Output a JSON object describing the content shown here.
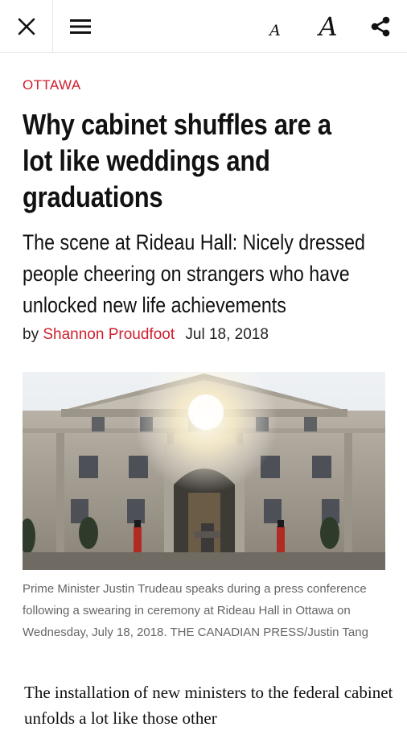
{
  "toolbar": {
    "close_icon": "close-icon",
    "menu_icon": "hamburger-menu-icon",
    "font_small_label": "A",
    "font_large_label": "A",
    "share_icon": "share-icon"
  },
  "article": {
    "section": "OTTAWA",
    "headline": "Why cabinet shuffles are a lot like weddings and graduations",
    "dek": "The scene at Rideau Hall: Nicely dressed people cheering on strangers who have unlocked new life achievements",
    "by_prefix": "by",
    "author": "Shannon Proudfoot",
    "date": "Jul 18, 2018",
    "caption": "Prime Minister Justin Trudeau speaks during a press conference following a swearing in ceremony at Rideau Hall in Ottawa on Wednesday, July 18, 2018. THE CANADIAN PRESS/Justin Tang",
    "body_start": "The installation of new ministers to the federal cabinet unfolds a lot like those other"
  },
  "colors": {
    "accent": "#cf1f2e",
    "caption": "#666666"
  }
}
